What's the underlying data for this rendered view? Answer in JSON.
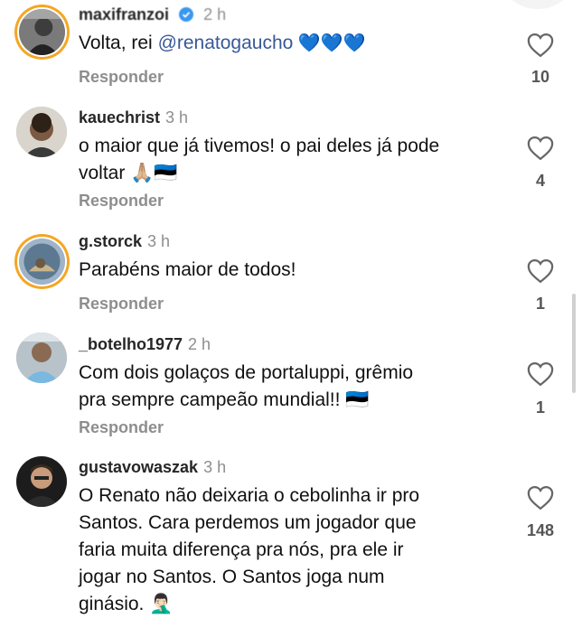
{
  "reply_label": "Responder",
  "comments": [
    {
      "username": "maxifranzoi",
      "time": "2 h",
      "verified": true,
      "text_parts": [
        "Volta, rei ",
        "@renatogaucho",
        " 💙💙💙"
      ],
      "likes": "10"
    },
    {
      "username": "kauechrist",
      "time": "3 h",
      "text_line1": "o maior que já tivemos! o pai deles já pode",
      "text_line2": "voltar 🙏🏼🇪🇪",
      "likes": "4"
    },
    {
      "username": "g.storck",
      "time": "3 h",
      "text": "Parabéns maior de todos!",
      "likes": "1"
    },
    {
      "username": "_botelho1977",
      "time": "2 h",
      "text_line1": "Com dois golaços de portaluppi, grêmio",
      "text_line2": "pra sempre campeão mundial!! 🇪🇪",
      "likes": "1"
    },
    {
      "username": "gustavowaszak",
      "time": "3 h",
      "lines": [
        "O Renato não deixaria o cebolinha ir pro",
        "Santos. Cara perdemos um jogador que",
        "faria muita diferença pra nós, pra ele ir",
        "jogar no Santos. O Santos joga num",
        "ginásio. 🤦🏻‍♂️"
      ],
      "likes": "148"
    }
  ],
  "icons": {
    "heart": "heart-outline-icon",
    "verified": "verified-badge-icon"
  },
  "colors": {
    "mention": "#385898",
    "secondary_text": "#8e8e8e",
    "story_ring": "#e1306c"
  }
}
